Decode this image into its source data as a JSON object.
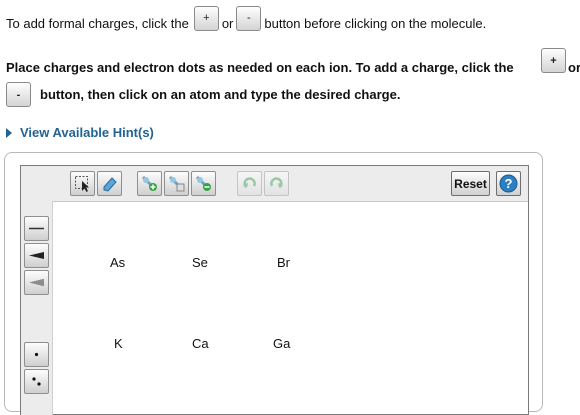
{
  "instructions": {
    "formal_charges_prefix": "To add formal charges, click the",
    "plus_label": "+",
    "or": "or",
    "minus_label": "-",
    "formal_charges_suffix": "button before clicking on the molecule.",
    "place_charges_line1": "Place charges and electron dots as needed on each ion. To add a charge, click the",
    "or2": "or",
    "place_charges_line2": "button, then click on an atom and type the desired charge."
  },
  "hint_link": "View Available Hint(s)",
  "toolbar": {
    "reset_label": "Reset",
    "help_label": "?",
    "tools": [
      "select-tool",
      "eraser-tool",
      "add-atom-tool",
      "add-bond-tool",
      "remove-atom-tool",
      "undo",
      "redo"
    ]
  },
  "left_tools": [
    "single-bond",
    "wedge-bond",
    "hash-bond",
    "single-electron-dot",
    "electron-pair-dots"
  ],
  "atoms": {
    "row1": [
      "As",
      "Se",
      "Br"
    ],
    "row2": [
      "K",
      "Ca",
      "Ga"
    ]
  },
  "colors": {
    "link": "#236391",
    "undo_disabled": "#9ac7a6"
  }
}
